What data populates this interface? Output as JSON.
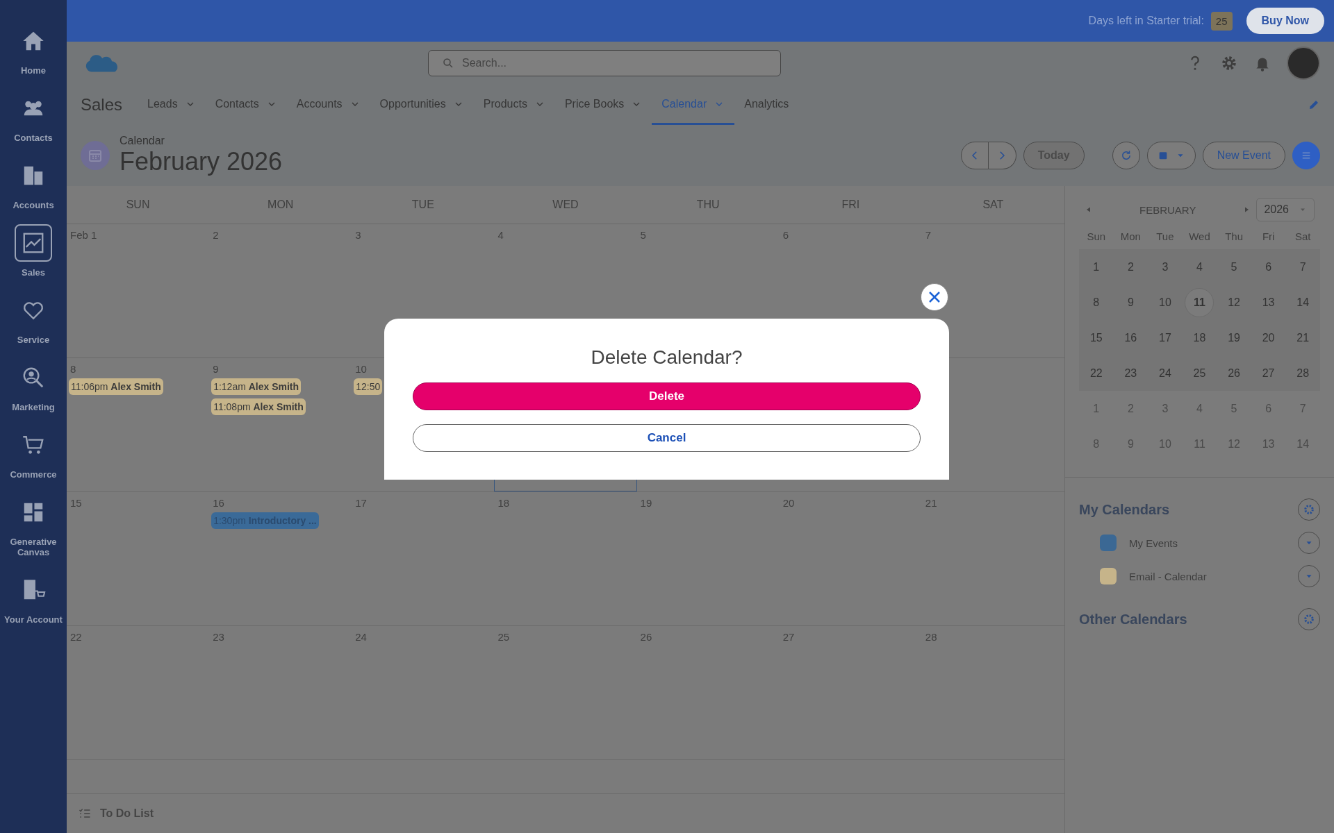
{
  "topbar": {
    "trial_label": "Days left in Starter trial:",
    "trial_days": "25",
    "buy_button": "Buy Now"
  },
  "sidebar": {
    "items": [
      {
        "label": "Home",
        "selected": false
      },
      {
        "label": "Contacts",
        "selected": false
      },
      {
        "label": "Accounts",
        "selected": false
      },
      {
        "label": "Sales",
        "selected": true
      },
      {
        "label": "Service",
        "selected": false
      },
      {
        "label": "Marketing",
        "selected": false
      },
      {
        "label": "Commerce",
        "selected": false
      },
      {
        "label": "Generative Canvas",
        "selected": false
      },
      {
        "label": "Your Account",
        "selected": false
      }
    ]
  },
  "search": {
    "placeholder": "Search..."
  },
  "app_name": "Sales",
  "nav_tabs": [
    {
      "label": "Leads",
      "dropdown": true,
      "selected": false
    },
    {
      "label": "Contacts",
      "dropdown": true,
      "selected": false
    },
    {
      "label": "Accounts",
      "dropdown": true,
      "selected": false
    },
    {
      "label": "Opportunities",
      "dropdown": true,
      "selected": false
    },
    {
      "label": "Products",
      "dropdown": true,
      "selected": false
    },
    {
      "label": "Price Books",
      "dropdown": true,
      "selected": false
    },
    {
      "label": "Calendar",
      "dropdown": true,
      "selected": true
    },
    {
      "label": "Analytics",
      "dropdown": false,
      "selected": false
    }
  ],
  "page_header": {
    "breadcrumb": "Calendar",
    "title": "February 2026",
    "today_button": "Today",
    "new_event_button": "New Event"
  },
  "calendar": {
    "weekdays": [
      "SUN",
      "MON",
      "TUE",
      "WED",
      "THU",
      "FRI",
      "SAT"
    ],
    "weeks": [
      [
        {
          "label": "Feb 1",
          "today": false
        },
        {
          "label": "2",
          "today": false
        },
        {
          "label": "3",
          "today": false
        },
        {
          "label": "4",
          "today": false
        },
        {
          "label": "5",
          "today": false
        },
        {
          "label": "6",
          "today": false
        },
        {
          "label": "7",
          "today": false
        }
      ],
      [
        {
          "label": "8",
          "today": false,
          "events": [
            {
              "time": "11:06pm",
              "title": "Alex Smith",
              "color": "#c6b48a"
            }
          ]
        },
        {
          "label": "9",
          "today": false,
          "events": [
            {
              "time": "1:12am",
              "title": "Alex Smith",
              "color": "#c6b48a"
            },
            {
              "time": "11:08pm",
              "title": "Alex Smith",
              "color": "#c6b48a"
            }
          ]
        },
        {
          "label": "10",
          "today": false,
          "events": [
            {
              "time": "12:50",
              "color": "#c6b48a"
            }
          ]
        },
        {
          "today": true
        },
        {
          "today": false
        },
        {
          "today": false
        },
        {
          "today": false
        }
      ],
      [
        {
          "label": "15",
          "today": false
        },
        {
          "label": "16",
          "today": false,
          "events": [
            {
              "time": "1:30pm",
              "title": "Introductory ...",
              "color": "#3a6a98"
            }
          ]
        },
        {
          "label": "17",
          "today": false
        },
        {
          "label": "18",
          "today": false
        },
        {
          "label": "19",
          "today": false
        },
        {
          "label": "20",
          "today": false
        },
        {
          "label": "21",
          "today": false
        }
      ],
      [
        {
          "label": "22",
          "today": false
        },
        {
          "label": "23",
          "today": false
        },
        {
          "label": "24",
          "today": false
        },
        {
          "label": "25",
          "today": false
        },
        {
          "label": "26",
          "today": false
        },
        {
          "label": "27",
          "today": false
        },
        {
          "label": "28",
          "today": false
        }
      ]
    ]
  },
  "mini_calendar": {
    "month": "FEBRUARY",
    "year": "2026",
    "weekdays": [
      "Sun",
      "Mon",
      "Tue",
      "Wed",
      "Thu",
      "Fri",
      "Sat"
    ],
    "weeks": [
      [
        {
          "label": "1",
          "in_month": true,
          "today": false
        },
        {
          "label": "2",
          "in_month": true,
          "today": false
        },
        {
          "label": "3",
          "in_month": true,
          "today": false
        },
        {
          "label": "4",
          "in_month": true,
          "today": false
        },
        {
          "label": "5",
          "in_month": true,
          "today": false
        },
        {
          "label": "6",
          "in_month": true,
          "today": false
        },
        {
          "label": "7",
          "in_month": true,
          "today": false
        }
      ],
      [
        {
          "label": "8",
          "in_month": true,
          "today": false
        },
        {
          "label": "9",
          "in_month": true,
          "today": false
        },
        {
          "label": "10",
          "in_month": true,
          "today": false
        },
        {
          "label": "11",
          "in_month": true,
          "today": true
        },
        {
          "label": "12",
          "in_month": true,
          "today": false
        },
        {
          "label": "13",
          "in_month": true,
          "today": false
        },
        {
          "label": "14",
          "in_month": true,
          "today": false
        }
      ],
      [
        {
          "label": "15",
          "in_month": true,
          "today": false
        },
        {
          "label": "16",
          "in_month": true,
          "today": false
        },
        {
          "label": "17",
          "in_month": true,
          "today": false
        },
        {
          "label": "18",
          "in_month": true,
          "today": false
        },
        {
          "label": "19",
          "in_month": true,
          "today": false
        },
        {
          "label": "20",
          "in_month": true,
          "today": false
        },
        {
          "label": "21",
          "in_month": true,
          "today": false
        }
      ],
      [
        {
          "label": "22",
          "in_month": true,
          "today": false
        },
        {
          "label": "23",
          "in_month": true,
          "today": false
        },
        {
          "label": "24",
          "in_month": true,
          "today": false
        },
        {
          "label": "25",
          "in_month": true,
          "today": false
        },
        {
          "label": "26",
          "in_month": true,
          "today": false
        },
        {
          "label": "27",
          "in_month": true,
          "today": false
        },
        {
          "label": "28",
          "in_month": true,
          "today": false
        }
      ],
      [
        {
          "label": "1",
          "in_month": false,
          "today": false
        },
        {
          "label": "2",
          "in_month": false,
          "today": false
        },
        {
          "label": "3",
          "in_month": false,
          "today": false
        },
        {
          "label": "4",
          "in_month": false,
          "today": false
        },
        {
          "label": "5",
          "in_month": false,
          "today": false
        },
        {
          "label": "6",
          "in_month": false,
          "today": false
        },
        {
          "label": "7",
          "in_month": false,
          "today": false
        }
      ],
      [
        {
          "label": "8",
          "in_month": false,
          "today": false
        },
        {
          "label": "9",
          "in_month": false,
          "today": false
        },
        {
          "label": "10",
          "in_month": false,
          "today": false
        },
        {
          "label": "11",
          "in_month": false,
          "today": false
        },
        {
          "label": "12",
          "in_month": false,
          "today": false
        },
        {
          "label": "13",
          "in_month": false,
          "today": false
        },
        {
          "label": "14",
          "in_month": false,
          "today": false
        }
      ]
    ]
  },
  "my_calendars": {
    "title": "My Calendars",
    "items": [
      {
        "name": "My Events",
        "color": "#3b6894"
      },
      {
        "name": "Email - Calendar",
        "color": "#c6b48a"
      }
    ]
  },
  "other_calendars": {
    "title": "Other Calendars"
  },
  "todo": {
    "label": "To Do List"
  },
  "modal": {
    "title": "Delete Calendar?",
    "delete_button": "Delete",
    "cancel_button": "Cancel"
  }
}
